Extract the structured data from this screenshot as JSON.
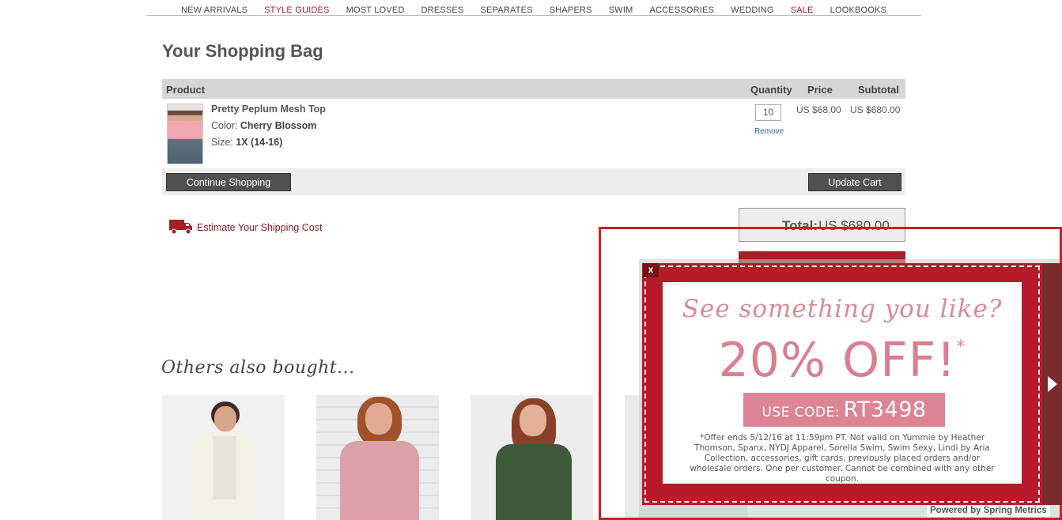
{
  "nav": {
    "items": [
      {
        "label": "NEW ARRIVALS",
        "highlight": false
      },
      {
        "label": "STYLE GUIDES",
        "highlight": true
      },
      {
        "label": "MOST LOVED",
        "highlight": false
      },
      {
        "label": "DRESSES",
        "highlight": false
      },
      {
        "label": "SEPARATES",
        "highlight": false
      },
      {
        "label": "SHAPERS",
        "highlight": false
      },
      {
        "label": "SWIM",
        "highlight": false
      },
      {
        "label": "ACCESSORIES",
        "highlight": false
      },
      {
        "label": "WEDDING",
        "highlight": false
      },
      {
        "label": "SALE",
        "highlight": true
      },
      {
        "label": "LOOKBOOKS",
        "highlight": false
      }
    ]
  },
  "page": {
    "title": "Your Shopping Bag"
  },
  "cart": {
    "headers": {
      "product": "Product",
      "quantity": "Quantity",
      "price": "Price",
      "subtotal": "Subtotal"
    },
    "item": {
      "name": "Pretty Peplum Mesh Top",
      "color_label": "Color:",
      "color_value": "Cherry Blossom",
      "size_label": "Size:",
      "size_value": "1X (14-16)",
      "quantity": "10",
      "remove_label": "Remove",
      "price": "US $68.00",
      "subtotal": "US $680.00"
    },
    "continue_label": "Continue Shopping",
    "update_label": "Update Cart",
    "shipping_label": "Estimate Your Shipping Cost",
    "total_label": "Total:",
    "total_value": "US $680.00"
  },
  "recommendations": {
    "title": "Others also bought..."
  },
  "popup": {
    "close_label": "x",
    "headline": "See something you like?",
    "offer": "20% OFF!",
    "offer_mark": "*",
    "code_prefix": "USE CODE:",
    "code": "RT3498",
    "fine_print": "*Offer ends 5/12/16 at 11:59pm PT.  Not valid on Yummie by Heather Thomson, Spanx, NYDJ Apparel, Sorella Swim, Swim Sexy, Lindi by Aria Collection, accessories, gift cards, previously placed orders and/or wholesale orders.  One per customer.  Cannot be combined with any other coupon.",
    "powered_by": "Powered by Spring Metrics"
  },
  "colors": {
    "brand_red": "#a31e25",
    "popup_red": "#b71a29",
    "popup_pink": "#db8595",
    "button_dark": "#505050"
  },
  "icons": [
    "truck-icon",
    "next-arrow-icon",
    "close-icon"
  ]
}
